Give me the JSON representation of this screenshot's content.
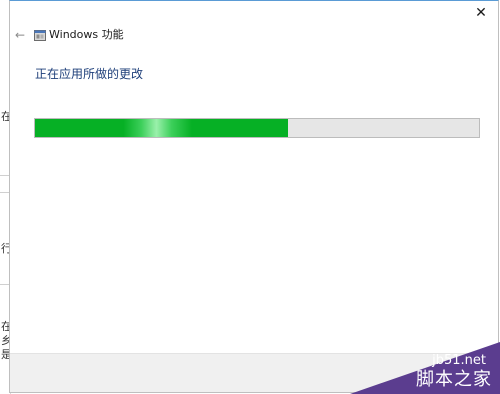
{
  "window": {
    "title": "Windows 功能",
    "back_icon": "back-arrow-icon",
    "close_icon": "close-icon",
    "app_icon": "windows-features-icon"
  },
  "main": {
    "heading": "正在应用所做的更改",
    "progress_percent": 57
  },
  "background": {
    "edge_marks": [
      "在",
      "行",
      "在",
      "乡",
      "是"
    ]
  },
  "watermark": {
    "url": "jb51.net",
    "name": "脚本之家"
  },
  "colors": {
    "accent_blue": "#1e3f7a",
    "progress_green": "#06b025",
    "track_gray": "#e6e6e6",
    "watermark_purple": "#5b3d8f"
  }
}
